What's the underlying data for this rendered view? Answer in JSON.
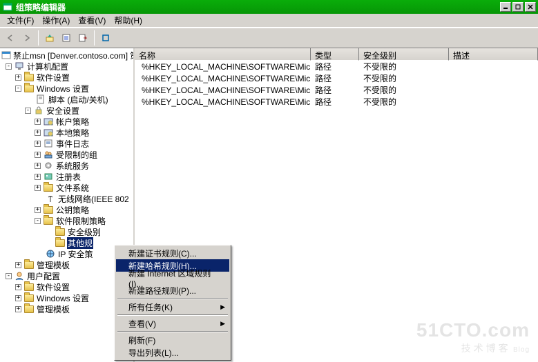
{
  "title": "组策略编辑器",
  "menus": {
    "file": "文件(F)",
    "action": "操作(A)",
    "view": "查看(V)",
    "help": "帮助(H)"
  },
  "tree": {
    "root": "禁止msn [Denver.contoso.com] 策",
    "computer_config": "计算机配置",
    "software_settings": "软件设置",
    "windows_settings": "Windows 设置",
    "scripts": "脚本 (启动/关机)",
    "security_settings": "安全设置",
    "account_policy": "帐户策略",
    "local_policy": "本地策略",
    "event_log": "事件日志",
    "restricted_groups": "受限制的组",
    "system_services": "系统服务",
    "registry": "注册表",
    "file_system": "文件系统",
    "wireless": "无线网络(IEEE 802",
    "pubkey_policy": "公钥策略",
    "software_restrict": "软件限制策略",
    "security_level": "安全级别",
    "other_rules": "其他规",
    "ip_security": "IP 安全策",
    "admin_templates": "管理模板",
    "user_config": "用户配置",
    "user_software": "软件设置",
    "user_windows": "Windows 设置",
    "user_admin_templates": "管理模板"
  },
  "columns": {
    "name": "名称",
    "type": "类型",
    "security": "安全级别",
    "desc": "描述"
  },
  "rows": [
    {
      "name": "%HKEY_LOCAL_MACHINE\\SOFTWARE\\Micro...",
      "type": "路径",
      "sec": "不受限的"
    },
    {
      "name": "%HKEY_LOCAL_MACHINE\\SOFTWARE\\Micro...",
      "type": "路径",
      "sec": "不受限的"
    },
    {
      "name": "%HKEY_LOCAL_MACHINE\\SOFTWARE\\Micro...",
      "type": "路径",
      "sec": "不受限的"
    },
    {
      "name": "%HKEY_LOCAL_MACHINE\\SOFTWARE\\Micro...",
      "type": "路径",
      "sec": "不受限的"
    }
  ],
  "context_menu": {
    "new_cert": "新建证书规则(C)...",
    "new_hash": "新建哈希规则(H)...",
    "new_inet": "新建 Internet 区域规则(I)...",
    "new_path": "新建路径规则(P)...",
    "all_tasks": "所有任务(K)",
    "view": "查看(V)",
    "refresh": "刷新(F)",
    "export": "导出列表(L)..."
  },
  "watermark": {
    "big": "51CTO.com",
    "small": "技术博客",
    "blog": "Blog"
  }
}
